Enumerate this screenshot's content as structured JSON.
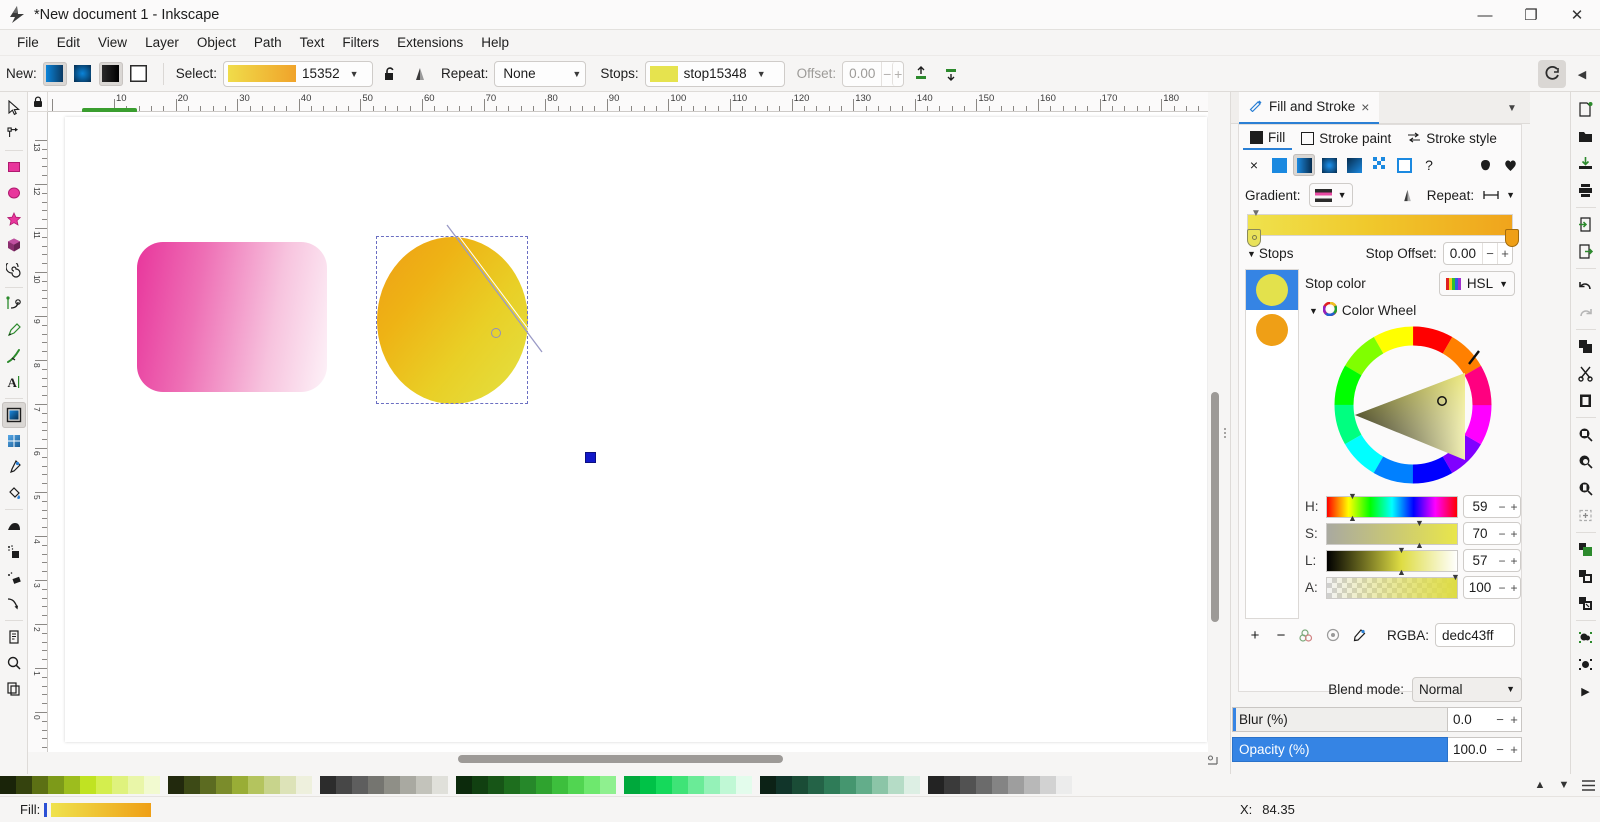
{
  "window": {
    "title": "*New document 1 - Inkscape",
    "logo_icon": "inkscape-logo-icon",
    "buttons": [
      {
        "name": "minimize-button",
        "glyph": "—"
      },
      {
        "name": "maximize-button",
        "glyph": "❐"
      },
      {
        "name": "close-button",
        "glyph": "✕"
      }
    ]
  },
  "menubar": {
    "items": [
      "File",
      "Edit",
      "View",
      "Layer",
      "Object",
      "Path",
      "Text",
      "Filters",
      "Extensions",
      "Help"
    ]
  },
  "toolbar": {
    "new_label": "New:",
    "new_types": [
      {
        "name": "linear-gradient-button",
        "swatch": "lin-blue",
        "active": true
      },
      {
        "name": "radial-gradient-button",
        "swatch": "rad-blue",
        "active": false
      },
      {
        "name": "edit-gradient-fill-button",
        "swatch": "lin-blk",
        "active": true
      },
      {
        "name": "edit-gradient-stroke-button",
        "swatch": "hollow",
        "active": false
      }
    ],
    "select_label": "Select:",
    "select_value": "15352",
    "lock_icon": "unlocked-padlock-icon",
    "reverse_icon": "reverse-gradient-icon",
    "repeat_label": "Repeat:",
    "repeat_value": "None",
    "stops_label": "Stops:",
    "stops_value": "stop15348",
    "offset_label": "Offset:",
    "offset_value": "0.00",
    "insert_stop_icon": "insert-stop-icon",
    "delete_stop_icon": "delete-stop-icon",
    "right_buttons": [
      {
        "name": "snap-controls-toggle-button",
        "icon": "snap-icon"
      },
      {
        "name": "toolbar-overflow-button",
        "icon": "chevron-left-icon"
      }
    ]
  },
  "toolbox": {
    "tools": [
      {
        "name": "tool-selector",
        "icon": "arrow-cursor-icon",
        "active": false
      },
      {
        "name": "tool-node-editor",
        "icon": "node-editor-icon",
        "active": false
      },
      {
        "name": "tool-rectangle",
        "icon": "rectangle-icon",
        "active": false
      },
      {
        "name": "tool-ellipse",
        "icon": "ellipse-icon",
        "active": false
      },
      {
        "name": "tool-star",
        "icon": "star-icon",
        "active": false
      },
      {
        "name": "tool-3dbox",
        "icon": "cube-3d-icon",
        "active": false
      },
      {
        "name": "tool-spiral",
        "icon": "spiral-icon",
        "active": false
      },
      {
        "name": "tool-pen",
        "icon": "bezier-pen-icon",
        "active": false
      },
      {
        "name": "tool-pencil",
        "icon": "pencil-icon",
        "active": false
      },
      {
        "name": "tool-calligraphy",
        "icon": "calligraphy-icon",
        "active": false
      },
      {
        "name": "tool-text",
        "icon": "text-a-icon",
        "active": false
      },
      {
        "name": "tool-gradient",
        "icon": "gradient-icon",
        "active": true
      },
      {
        "name": "tool-mesh",
        "icon": "mesh-gradient-icon",
        "active": false
      },
      {
        "name": "tool-dropper",
        "icon": "eyedropper-icon",
        "active": false
      },
      {
        "name": "tool-paint-bucket",
        "icon": "paint-bucket-icon",
        "active": false
      },
      {
        "name": "tool-tweak",
        "icon": "tweak-icon",
        "active": false
      },
      {
        "name": "tool-spray",
        "icon": "spray-can-icon",
        "active": false
      },
      {
        "name": "tool-eraser",
        "icon": "eraser-icon",
        "active": false
      },
      {
        "name": "tool-connector",
        "icon": "connector-arrow-icon",
        "active": false
      },
      {
        "name": "tool-pages",
        "icon": "page-icon",
        "active": false
      },
      {
        "name": "tool-zoom",
        "icon": "magnifier-icon",
        "active": false
      },
      {
        "name": "tool-measure",
        "icon": "copies-icon",
        "active": false
      }
    ]
  },
  "rulers": {
    "h_labels": [
      "10",
      "20",
      "30",
      "40",
      "50",
      "60",
      "70",
      "80",
      "90",
      "100",
      "110",
      "120",
      "130",
      "140",
      "150",
      "160",
      "170",
      "180"
    ],
    "v_labels": [
      "13",
      "12",
      "11",
      "10",
      "9",
      "8",
      "7",
      "6",
      "5",
      "4",
      "3",
      "2",
      "1",
      "0"
    ],
    "lock_icon": "ruler-lock-icon"
  },
  "canvas": {
    "rect_shape": {
      "name": "rounded-rect-pink-gradient"
    },
    "circle_shape": {
      "name": "circle-yellow-orange-gradient"
    },
    "gradient_start_handle": "gradient-start-handle",
    "gradient_end_handle": "gradient-end-handle"
  },
  "dock": {
    "tab_title": "Fill and Stroke",
    "tab_icon": "fill-stroke-icon",
    "tab_close_icon": "close-icon",
    "collapse_icon": "chevron-down-icon",
    "fs_tabs": [
      {
        "name": "tab-fill",
        "label": "Fill",
        "icon": "filled-square-icon",
        "active": true
      },
      {
        "name": "tab-stroke-paint",
        "label": "Stroke paint",
        "icon": "hollow-square-icon",
        "active": false
      },
      {
        "name": "tab-stroke-style",
        "label": "Stroke style",
        "icon": "stroke-style-icon",
        "active": false
      }
    ],
    "paint_buttons": [
      {
        "name": "paint-none-button",
        "icon": "x-icon",
        "selected": false
      },
      {
        "name": "paint-flat-button",
        "icon": "flat-color-icon",
        "selected": false
      },
      {
        "name": "paint-linear-gradient-button",
        "icon": "linear-gradient-icon",
        "selected": true
      },
      {
        "name": "paint-radial-gradient-button",
        "icon": "radial-gradient-icon",
        "selected": false
      },
      {
        "name": "paint-mesh-gradient-button",
        "icon": "mesh-gradient-icon",
        "selected": false
      },
      {
        "name": "paint-pattern-button",
        "icon": "pattern-icon",
        "selected": false
      },
      {
        "name": "paint-swatch-button",
        "icon": "swatch-icon",
        "selected": false
      },
      {
        "name": "paint-unknown-button",
        "icon": "question-mark-icon",
        "selected": false
      }
    ],
    "fill_rule_buttons": [
      {
        "name": "fill-rule-nonzero-button",
        "icon": "fill-rule-nonzero-icon"
      },
      {
        "name": "fill-rule-evenodd-button",
        "icon": "fill-rule-evenodd-icon"
      }
    ],
    "gradient_label": "Gradient:",
    "gradient_select_icon": "gradient-list-icon",
    "edit_gradient_icon": "edit-gradient-icon",
    "repeat_label": "Repeat:",
    "repeat_icon": "repeat-none-icon",
    "stops_label": "Stops",
    "stop_offset_label": "Stop Offset:",
    "stop_offset_value": "0.00",
    "stop_color_label": "Stop color",
    "color_mode": "HSL",
    "color_mode_icon": "rainbow-icon",
    "color_wheel_label": "Color Wheel",
    "color_wheel_icon": "color-wheel-icon",
    "stop_swatches": [
      {
        "name": "gradient-stop-1",
        "color": "#e3e14c",
        "selected": true
      },
      {
        "name": "gradient-stop-2",
        "color": "#ef9f16",
        "selected": false
      }
    ],
    "hsl": [
      {
        "key": "H:",
        "value": "59",
        "name": "hue-slider"
      },
      {
        "key": "S:",
        "value": "70",
        "name": "saturation-slider"
      },
      {
        "key": "L:",
        "value": "57",
        "name": "lightness-slider"
      },
      {
        "key": "A:",
        "value": "100",
        "name": "alpha-slider"
      }
    ],
    "stop_actions": [
      {
        "name": "add-stop-button",
        "glyph": "+"
      },
      {
        "name": "remove-stop-button",
        "glyph": "−"
      },
      {
        "name": "stop-color-group-button",
        "icon": "color-group-icon"
      },
      {
        "name": "stop-target-button",
        "icon": "target-icon"
      },
      {
        "name": "pick-color-button",
        "icon": "eyedropper-icon"
      }
    ],
    "rgba_label": "RGBA:",
    "rgba_value": "dedc43ff",
    "blend_mode_label": "Blend mode:",
    "blend_mode_value": "Normal",
    "blur_label": "Blur (%)",
    "blur_value": "0.0",
    "opacity_label": "Opacity (%)",
    "opacity_value": "100.0"
  },
  "commands": [
    {
      "name": "new-document-button",
      "icon": "new-document-icon"
    },
    {
      "name": "open-document-button",
      "icon": "open-folder-icon"
    },
    {
      "name": "save-document-button",
      "icon": "save-icon"
    },
    {
      "name": "print-document-button",
      "icon": "printer-icon"
    },
    {
      "name": "import-button",
      "icon": "import-icon"
    },
    {
      "name": "export-button",
      "icon": "export-icon"
    },
    {
      "name": "undo-button",
      "icon": "undo-arrow-icon"
    },
    {
      "name": "redo-button",
      "icon": "redo-arrow-icon"
    },
    {
      "name": "copy-button",
      "icon": "copy-icon"
    },
    {
      "name": "cut-button",
      "icon": "scissors-icon"
    },
    {
      "name": "paste-button",
      "icon": "clipboard-icon"
    },
    {
      "name": "zoom-selection-button",
      "icon": "zoom-selection-icon"
    },
    {
      "name": "zoom-drawing-button",
      "icon": "zoom-drawing-icon"
    },
    {
      "name": "zoom-page-button",
      "icon": "zoom-page-icon"
    },
    {
      "name": "zoom-fit-button",
      "icon": "zoom-fit-icon"
    },
    {
      "name": "duplicate-button",
      "icon": "duplicate-icon"
    },
    {
      "name": "clone-button",
      "icon": "clone-icon"
    },
    {
      "name": "unlink-clone-button",
      "icon": "unlink-clone-icon"
    },
    {
      "name": "group-button",
      "icon": "group-icon"
    },
    {
      "name": "ungroup-button",
      "icon": "ungroup-icon"
    },
    {
      "name": "more-commands-button",
      "icon": "triangle-right-icon"
    }
  ],
  "palette": {
    "scroll_up_icon": "chevron-up-icon",
    "scroll_down_icon": "chevron-down-icon",
    "menu_icon": "hamburger-menu-icon",
    "groups": [
      [
        "#1a2409",
        "#35430e",
        "#5c7014",
        "#7d9a19",
        "#9dbd1e",
        "#c0e322",
        "#d4ee4e",
        "#dff27d",
        "#e9f6a8",
        "#f2fad0"
      ],
      [
        "#22290d",
        "#3d4a16",
        "#5c6b21",
        "#7b8c2b",
        "#99ad36",
        "#b4c45e",
        "#c8d48c",
        "#dde3b8",
        "#eef0dd"
      ],
      [
        "#2c2c2c",
        "#474747",
        "#5e5e5e",
        "#757570",
        "#8f8f87",
        "#a9a9a1",
        "#c3c3bb",
        "#e0e0da"
      ],
      [
        "#0c2a0c",
        "#114011",
        "#175517",
        "#1e6e1e",
        "#26882a",
        "#2fa32f",
        "#3dbf3d",
        "#51d551",
        "#6ee86e",
        "#8ff08f"
      ],
      [
        "#00a83c",
        "#00c247",
        "#15d95b",
        "#3fe377",
        "#6aeb97",
        "#95f2b8",
        "#c0f8d5",
        "#e3fcec"
      ],
      [
        "#0c2216",
        "#11352a",
        "#1a4c36",
        "#246347",
        "#2f7c58",
        "#45966f",
        "#63ad8a",
        "#8bc5a7",
        "#b5dcc6",
        "#ddefe4"
      ],
      [
        "#232323",
        "#3a3a3a",
        "#525252",
        "#6b6b6b",
        "#848484",
        "#9e9e9e",
        "#b8b8b8",
        "#d2d2d2",
        "#ececec"
      ]
    ]
  },
  "statusbar": {
    "fill_label": "Fill:",
    "coord_x_label": "X:",
    "coord_x_value": "84.35"
  }
}
